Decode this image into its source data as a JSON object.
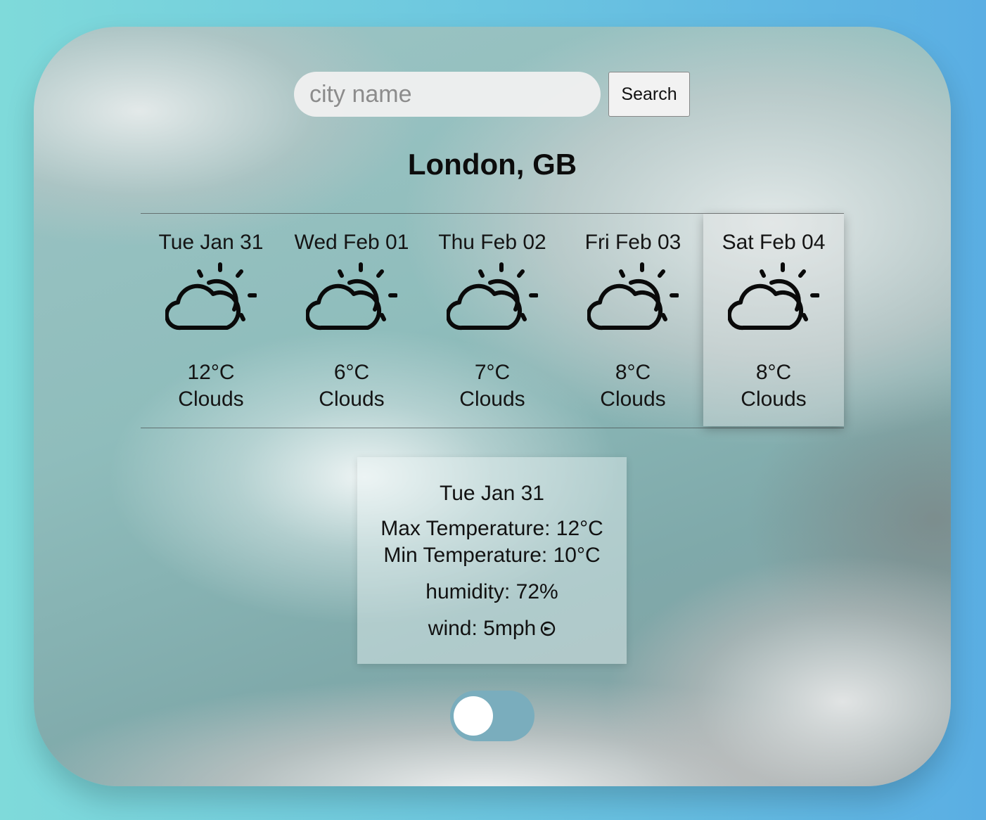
{
  "search": {
    "placeholder": "city name",
    "value": "",
    "button_label": "Search"
  },
  "location": {
    "title": "London, GB"
  },
  "forecast": [
    {
      "date": "Tue Jan 31",
      "icon": "partly-cloudy-icon",
      "temp": "12°C",
      "condition": "Clouds",
      "selected": false
    },
    {
      "date": "Wed Feb 01",
      "icon": "partly-cloudy-icon",
      "temp": "6°C",
      "condition": "Clouds",
      "selected": false
    },
    {
      "date": "Thu Feb 02",
      "icon": "partly-cloudy-icon",
      "temp": "7°C",
      "condition": "Clouds",
      "selected": false
    },
    {
      "date": "Fri Feb 03",
      "icon": "partly-cloudy-icon",
      "temp": "8°C",
      "condition": "Clouds",
      "selected": false
    },
    {
      "date": "Sat Feb 04",
      "icon": "partly-cloudy-icon",
      "temp": "8°C",
      "condition": "Clouds",
      "selected": true
    }
  ],
  "details": {
    "date": "Tue Jan 31",
    "max_temp": "Max Temperature: 12°C",
    "min_temp": "Min Temperature: 10°C",
    "humidity": "humidity: 72%",
    "wind": "wind: 5mph",
    "wind_icon": "wind-direction-icon"
  },
  "toggle": {
    "state": "off",
    "track_color": "#7aadbd"
  }
}
